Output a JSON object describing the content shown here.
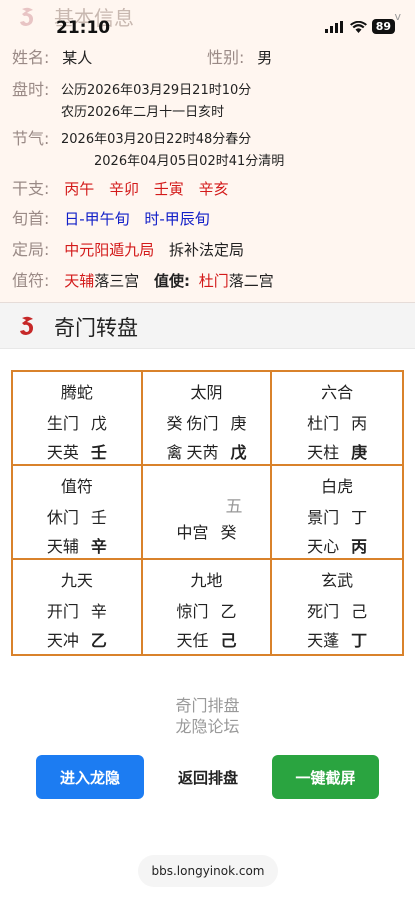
{
  "status_bar": {
    "time": "21:10",
    "battery": "89"
  },
  "info": {
    "title": "基本信息",
    "name_label": "姓名:",
    "name_value": "某人",
    "gender_label": "性别:",
    "gender_value": "男",
    "time_label": "盘时:",
    "time_solar": "公历2026年03月29日21时10分",
    "time_lunar": "农历2026年二月十一日亥时",
    "solar_term_label": "节气:",
    "solar_term_1": "2026年03月20日22时48分春分",
    "solar_term_2": "2026年04月05日02时41分清明",
    "ganzhi_label": "干支:",
    "ganzhi": [
      "丙午",
      "辛卯",
      "壬寅",
      "辛亥"
    ],
    "xunshou_label": "旬首:",
    "xunshou": [
      "日-甲午旬",
      "时-甲辰旬"
    ],
    "ju_label": "定局:",
    "ju_value": "中元阳遁九局",
    "ju_method": "拆补法定局",
    "zhifu_label": "值符:",
    "zhifu_star": "天辅",
    "zhifu_palace": "落三宫",
    "zhishi_label": "值使:",
    "zhishi_door": "杜门",
    "zhishi_palace": "落二宫"
  },
  "panel": {
    "title": "奇门转盘",
    "cells": [
      {
        "god": "腾蛇",
        "door": "生门",
        "tian_gan": "戊",
        "star": "天英",
        "di_gan": "壬"
      },
      {
        "god": "太阴",
        "prefix": "癸",
        "door": "伤门",
        "tian_gan": "庚",
        "prefix2": "禽",
        "star": "天芮",
        "di_gan": "戊"
      },
      {
        "god": "六合",
        "door": "杜门",
        "tian_gan": "丙",
        "star": "天柱",
        "di_gan": "庚"
      },
      {
        "god": "值符",
        "door": "休门",
        "tian_gan": "壬",
        "star": "天辅",
        "di_gan": "辛"
      },
      {
        "number": "五",
        "center_label": "中宫",
        "center_gan": "癸"
      },
      {
        "god": "白虎",
        "door": "景门",
        "tian_gan": "丁",
        "star": "天心",
        "di_gan": "丙"
      },
      {
        "god": "九天",
        "door": "开门",
        "tian_gan": "辛",
        "star": "天冲",
        "di_gan": "乙"
      },
      {
        "god": "九地",
        "door": "惊门",
        "tian_gan": "乙",
        "star": "天任",
        "di_gan": "己"
      },
      {
        "god": "玄武",
        "door": "死门",
        "tian_gan": "己",
        "star": "天蓬",
        "di_gan": "丁"
      }
    ]
  },
  "footer": {
    "line1": "奇门排盘",
    "line2": "龙隐论坛",
    "btn_enter": "进入龙隐",
    "btn_back": "返回排盘",
    "btn_screenshot": "一键截屏",
    "url": "bbs.longyinok.com"
  },
  "colors": {
    "accent_red": "#d31a1a",
    "accent_blue": "#1320c8",
    "grid_border": "#d9822b",
    "btn_blue": "#1c7cf2",
    "btn_green": "#2aa440"
  }
}
